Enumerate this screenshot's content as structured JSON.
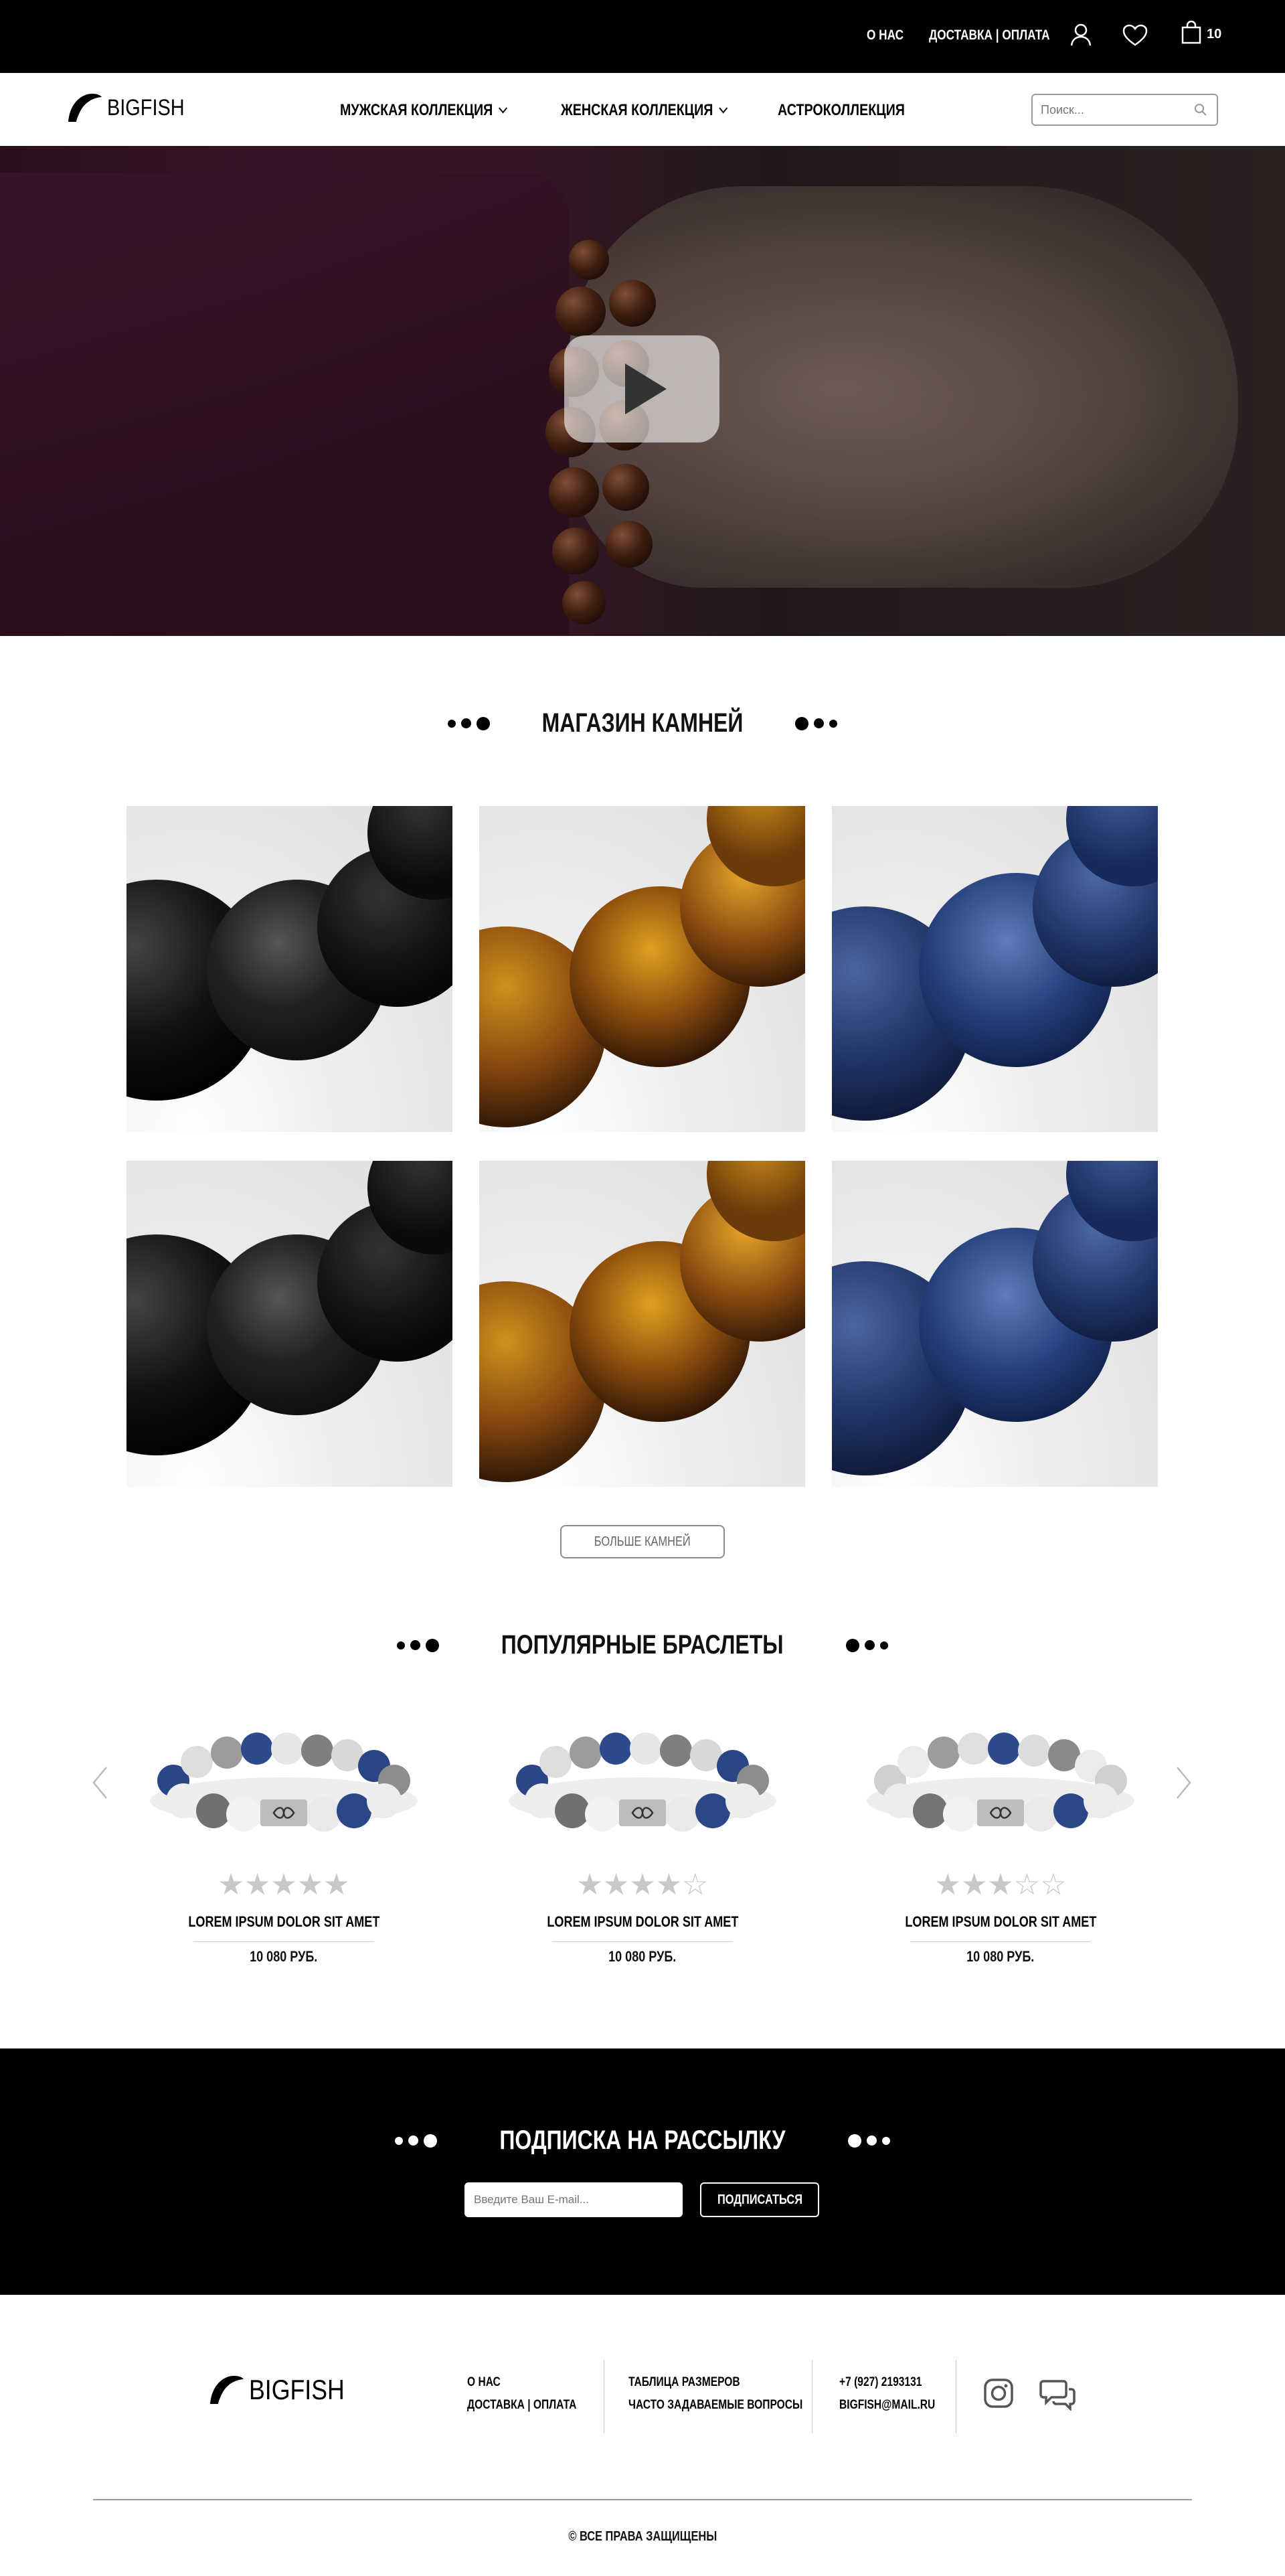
{
  "topbar": {
    "about": "О НАС",
    "delivery": "ДОСТАВКА",
    "payment": "ОПЛАТА",
    "cart_count": "10",
    "icons": [
      "user-icon",
      "heart-icon",
      "shopping-bag-icon"
    ]
  },
  "header": {
    "logo_text": "BIGFISH",
    "nav": [
      {
        "label": "МУЖСКАЯ КОЛЛЕКЦИЯ",
        "has_dropdown": true
      },
      {
        "label": "ЖЕНСКАЯ КОЛЛЕКЦИЯ",
        "has_dropdown": true
      },
      {
        "label": "АСТРОКОЛЛЕКЦИЯ",
        "has_dropdown": false
      }
    ],
    "search_placeholder": "Поиск..."
  },
  "stones": {
    "title": "МАГАЗИН КАМНЕЙ",
    "items": [
      "lava",
      "tiger-eye",
      "sodalite",
      "lava",
      "tiger-eye",
      "sodalite"
    ],
    "more_button": "БОЛЬШЕ КАМНЕЙ"
  },
  "bracelets": {
    "title": "ПОПУЛЯРНЫЕ БРАСЛЕТЫ",
    "items": [
      {
        "title": "LOREM IPSUM DOLOR SIT AMET",
        "price": "10 080 РУБ.",
        "rating": 5
      },
      {
        "title": "LOREM IPSUM DOLOR SIT AMET",
        "price": "10 080 РУБ.",
        "rating": 4
      },
      {
        "title": "LOREM IPSUM DOLOR SIT AMET",
        "price": "10 080 РУБ.",
        "rating": 3
      }
    ]
  },
  "subscribe": {
    "title": "ПОДПИСКА НА РАССЫЛКУ",
    "placeholder": "Введите Ваш E-mail...",
    "button": "ПОДПИСАТЬСЯ"
  },
  "footer": {
    "logo_text": "BIGFISH",
    "col1": [
      "О НАС",
      "ДОСТАВКА | ОПЛАТА"
    ],
    "col2": [
      "ТАБЛИЦА РАЗМЕРОВ",
      "ЧАСТО ЗАДАВАЕМЫЕ ВОПРОСЫ"
    ],
    "col3": [
      "+7 (927) 2193131",
      "BIGFISH@MAIL.RU"
    ],
    "social_icons": [
      "instagram-icon",
      "chat-icon"
    ],
    "copyright": "© ВСЕ ПРАВА ЗАЩИЩЕНЫ"
  },
  "colors": {
    "black": "#000000",
    "white": "#ffffff",
    "star": "#c8c8c8",
    "border": "#9a9a9a"
  }
}
